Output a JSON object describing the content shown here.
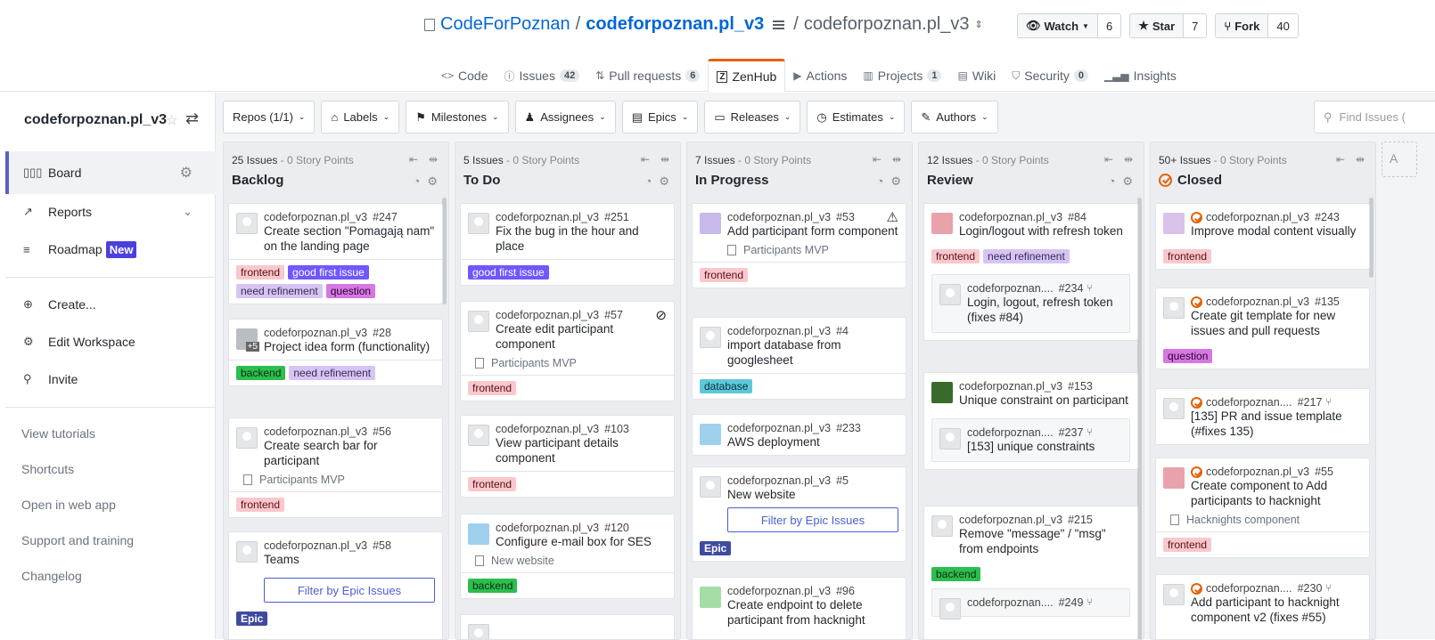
{
  "header": {
    "org": "CodeForPoznan",
    "slash": "/",
    "repo": "codeforpoznan.pl_v3",
    "slash2": "/",
    "workspace": "codeforpoznan.pl_v3",
    "watch": {
      "label": "Watch",
      "count": "6"
    },
    "star": {
      "label": "Star",
      "count": "7"
    },
    "fork": {
      "label": "Fork",
      "count": "40"
    }
  },
  "tabs": [
    {
      "label": "Code",
      "icon": "<>"
    },
    {
      "label": "Issues",
      "count": "42"
    },
    {
      "label": "Pull requests",
      "count": "6"
    },
    {
      "label": "ZenHub",
      "active": true
    },
    {
      "label": "Actions"
    },
    {
      "label": "Projects",
      "count": "1"
    },
    {
      "label": "Wiki"
    },
    {
      "label": "Security",
      "count": "0"
    },
    {
      "label": "Insights"
    }
  ],
  "sidebar": {
    "workspace": "codeforpoznan.pl_v3",
    "board": "Board",
    "reports": "Reports",
    "roadmap": "Roadmap",
    "new_badge": "New",
    "create": "Create...",
    "edit": "Edit Workspace",
    "invite": "Invite",
    "links": [
      "View tutorials",
      "Shortcuts",
      "Open in web app",
      "Support and training",
      "Changelog"
    ]
  },
  "filters": [
    "Repos (1/1)",
    "Labels",
    "Milestones",
    "Assignees",
    "Epics",
    "Releases",
    "Estimates",
    "Authors"
  ],
  "find_placeholder": "Find Issues (",
  "pipelines": [
    {
      "count": "25 Issues",
      "points": " - 0 Story Points",
      "name": "Backlog"
    },
    {
      "count": "5 Issues",
      "points": " - 0 Story Points",
      "name": "To Do"
    },
    {
      "count": "7 Issues",
      "points": " - 0 Story Points",
      "name": "In Progress"
    },
    {
      "count": "12 Issues",
      "points": " - 0 Story Points",
      "name": "Review"
    },
    {
      "count": "50+ Issues",
      "points": " - 0 Story Points",
      "name": "Closed"
    }
  ],
  "cards": {
    "c247": {
      "repo": "codeforpoznan.pl_v3",
      "num": "#247",
      "title": "Create section \"Pomagają nam\" on the landing page",
      "labels": [
        "frontend",
        "good first issue",
        "need refinement",
        "question"
      ]
    },
    "c28": {
      "repo": "codeforpoznan.pl_v3",
      "num": "#28",
      "title": "Project idea form (functionality)",
      "labels": [
        "backend",
        "need refinement"
      ],
      "avatar_more": "+5"
    },
    "c56": {
      "repo": "codeforpoznan.pl_v3",
      "num": "#56",
      "title": "Create search bar for participant",
      "epic": "Participants MVP",
      "labels": [
        "frontend"
      ]
    },
    "c58": {
      "repo": "codeforpoznan.pl_v3",
      "num": "#58",
      "title": "Teams",
      "filter": "Filter by Epic Issues",
      "labels": [
        "Epic"
      ]
    },
    "c251": {
      "repo": "codeforpoznan.pl_v3",
      "num": "#251",
      "title": "Fix the bug in the hour and place",
      "labels": [
        "good first issue"
      ]
    },
    "c57": {
      "repo": "codeforpoznan.pl_v3",
      "num": "#57",
      "title": "Create edit participant component",
      "epic": "Participants MVP",
      "labels": [
        "frontend"
      ]
    },
    "c103": {
      "repo": "codeforpoznan.pl_v3",
      "num": "#103",
      "title": "View participant details component",
      "labels": [
        "frontend"
      ]
    },
    "c120": {
      "repo": "codeforpoznan.pl_v3",
      "num": "#120",
      "title": "Configure e-mail box for SES",
      "epic": "New website",
      "labels": [
        "backend"
      ]
    },
    "c53": {
      "repo": "codeforpoznan.pl_v3",
      "num": "#53",
      "title": "Add participant form component",
      "epic": "Participants MVP",
      "labels": [
        "frontend"
      ]
    },
    "c4": {
      "repo": "codeforpoznan.pl_v3",
      "num": "#4",
      "title": "import database from googlesheet",
      "labels": [
        "database"
      ]
    },
    "c233": {
      "repo": "codeforpoznan.pl_v3",
      "num": "#233",
      "title": "AWS deployment"
    },
    "c5": {
      "repo": "codeforpoznan.pl_v3",
      "num": "#5",
      "title": "New website",
      "filter": "Filter by Epic Issues",
      "labels": [
        "Epic"
      ]
    },
    "c96": {
      "repo": "codeforpoznan.pl_v3",
      "num": "#96",
      "title": "Create endpoint to delete participant from hacknight"
    },
    "c84": {
      "repo": "codeforpoznan.pl_v3",
      "num": "#84",
      "title": "Login/logout with refresh token",
      "labels": [
        "frontend",
        "need refinement"
      ]
    },
    "c234": {
      "repo": "codeforpoznan....",
      "num": "#234",
      "title": "Login, logout, refresh token (fixes #84)"
    },
    "c153": {
      "repo": "codeforpoznan.pl_v3",
      "num": "#153",
      "title": "Unique constraint on participant"
    },
    "c237": {
      "repo": "codeforpoznan....",
      "num": "#237",
      "title": "[153] unique constraints"
    },
    "c215": {
      "repo": "codeforpoznan.pl_v3",
      "num": "#215",
      "title": "Remove \"message\" / \"msg\" from endpoints",
      "labels": [
        "backend"
      ]
    },
    "c249": {
      "repo": "codeforpoznan....",
      "num": "#249"
    },
    "c243": {
      "repo": "codeforpoznan.pl_v3",
      "num": "#243",
      "title": "Improve modal content visually",
      "labels": [
        "frontend"
      ]
    },
    "c135": {
      "repo": "codeforpoznan.pl_v3",
      "num": "#135",
      "title": "Create git template for new issues and pull requests",
      "labels": [
        "question"
      ]
    },
    "c217": {
      "repo": "codeforpoznan....",
      "num": "#217",
      "title": "[135] PR and issue template (#fixes 135)"
    },
    "c55": {
      "repo": "codeforpoznan.pl_v3",
      "num": "#55",
      "title": "Create component to Add participants to hacknight",
      "epic": "Hacknights component",
      "labels": [
        "frontend"
      ]
    },
    "c230": {
      "repo": "codeforpoznan....",
      "num": "#230",
      "title": "Add participant to hacknight component v2 (fixes #55)"
    }
  },
  "colors": {
    "accent": "#5a61c7",
    "zenhub_tab": "#e36209",
    "new_badge": "#4b3fe0",
    "link": "#0366d6"
  }
}
